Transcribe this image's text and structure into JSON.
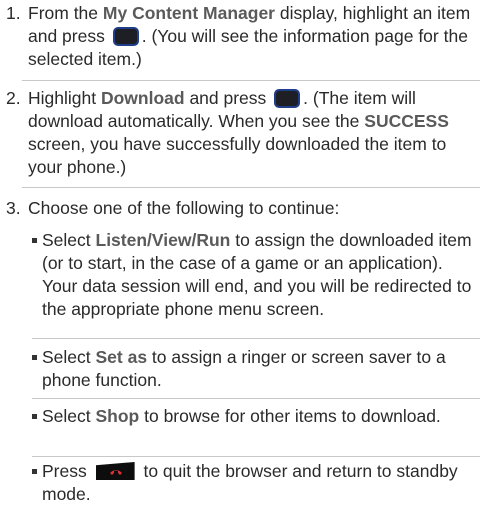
{
  "steps": [
    {
      "number": "1.",
      "parts": [
        "From the ",
        "My Content Manager",
        " display, highlight an item and press ",
        ". (You will see the information page for the selected item.)"
      ]
    },
    {
      "number": "2.",
      "parts": [
        "Highlight ",
        "Download",
        " and press ",
        ". (The item will download automatically. When you see the ",
        "SUCCESS",
        " screen, you have successfully downloaded the item to your phone.)"
      ]
    },
    {
      "number": "3.",
      "text": "Choose one of the following to continue:"
    }
  ],
  "bullets": [
    {
      "pre": "Select ",
      "bold": "Listen/View/Run",
      "post": " to assign the downloaded item (or to start, in the case of a game or an application). Your data session will end, and you will be redirected to the appropriate phone menu screen."
    },
    {
      "pre": "Select ",
      "bold": "Set as",
      "post": " to assign a ringer or screen saver to a phone function."
    },
    {
      "pre": "Select ",
      "bold": "Shop",
      "post": " to browse for other items to download."
    },
    {
      "pre": "Press ",
      "post": " to quit the browser and return to standby mode."
    }
  ],
  "icons": {
    "menu_ok_key": "menu-ok-key-icon",
    "end_key": "end-key-icon",
    "end_key_color": "#d8323a",
    "menu_key_border": "#1f3d88"
  }
}
